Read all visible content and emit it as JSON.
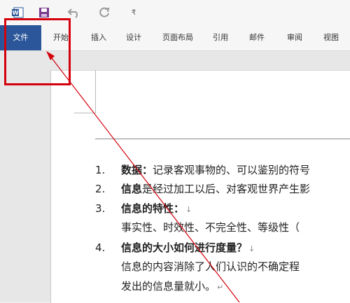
{
  "qat": {
    "customize": "₹"
  },
  "tabs": {
    "file": "文件",
    "start": "开始",
    "insert": "插入",
    "design": "设计",
    "layout": "页面布局",
    "references": "引用",
    "mailings": "邮件",
    "review": "审阅",
    "view": "视图"
  },
  "document": {
    "items": [
      {
        "num": "1.",
        "bold": "数据：",
        "text": "记录客观事物的、可以鉴别的符号"
      },
      {
        "num": "2.",
        "bold": "信息",
        "text": "是经过加工以后、对客观世界产生影"
      },
      {
        "num": "3.",
        "bold": "信息的特性：",
        "text": "",
        "mark": "↓"
      },
      {
        "num": "",
        "bold": "",
        "text": "事实性、时效性、不完全性、等级性（"
      },
      {
        "num": "4.",
        "bold": "信息的大小如何进行度量？",
        "text": "",
        "mark": "↓"
      },
      {
        "num": "",
        "bold": "",
        "text": "信息的内容消除了人们认识的不确定程"
      },
      {
        "num": "",
        "bold": "",
        "text": "发出的信息量就小。",
        "mark": "↵"
      }
    ]
  },
  "colors": {
    "accent": "#2b579a",
    "annotation": "#d4000c"
  }
}
